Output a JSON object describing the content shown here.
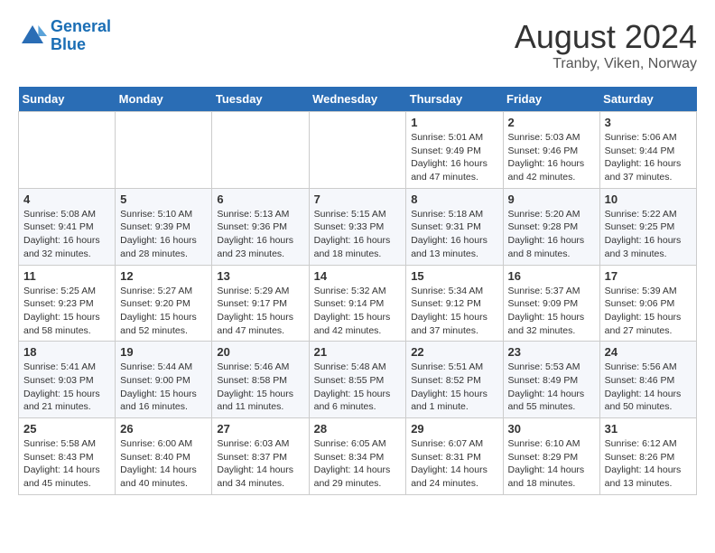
{
  "logo": {
    "line1": "General",
    "line2": "Blue"
  },
  "title": "August 2024",
  "subtitle": "Tranby, Viken, Norway",
  "header_days": [
    "Sunday",
    "Monday",
    "Tuesday",
    "Wednesday",
    "Thursday",
    "Friday",
    "Saturday"
  ],
  "weeks": [
    [
      {
        "day": "",
        "info": ""
      },
      {
        "day": "",
        "info": ""
      },
      {
        "day": "",
        "info": ""
      },
      {
        "day": "",
        "info": ""
      },
      {
        "day": "1",
        "info": "Sunrise: 5:01 AM\nSunset: 9:49 PM\nDaylight: 16 hours\nand 47 minutes."
      },
      {
        "day": "2",
        "info": "Sunrise: 5:03 AM\nSunset: 9:46 PM\nDaylight: 16 hours\nand 42 minutes."
      },
      {
        "day": "3",
        "info": "Sunrise: 5:06 AM\nSunset: 9:44 PM\nDaylight: 16 hours\nand 37 minutes."
      }
    ],
    [
      {
        "day": "4",
        "info": "Sunrise: 5:08 AM\nSunset: 9:41 PM\nDaylight: 16 hours\nand 32 minutes."
      },
      {
        "day": "5",
        "info": "Sunrise: 5:10 AM\nSunset: 9:39 PM\nDaylight: 16 hours\nand 28 minutes."
      },
      {
        "day": "6",
        "info": "Sunrise: 5:13 AM\nSunset: 9:36 PM\nDaylight: 16 hours\nand 23 minutes."
      },
      {
        "day": "7",
        "info": "Sunrise: 5:15 AM\nSunset: 9:33 PM\nDaylight: 16 hours\nand 18 minutes."
      },
      {
        "day": "8",
        "info": "Sunrise: 5:18 AM\nSunset: 9:31 PM\nDaylight: 16 hours\nand 13 minutes."
      },
      {
        "day": "9",
        "info": "Sunrise: 5:20 AM\nSunset: 9:28 PM\nDaylight: 16 hours\nand 8 minutes."
      },
      {
        "day": "10",
        "info": "Sunrise: 5:22 AM\nSunset: 9:25 PM\nDaylight: 16 hours\nand 3 minutes."
      }
    ],
    [
      {
        "day": "11",
        "info": "Sunrise: 5:25 AM\nSunset: 9:23 PM\nDaylight: 15 hours\nand 58 minutes."
      },
      {
        "day": "12",
        "info": "Sunrise: 5:27 AM\nSunset: 9:20 PM\nDaylight: 15 hours\nand 52 minutes."
      },
      {
        "day": "13",
        "info": "Sunrise: 5:29 AM\nSunset: 9:17 PM\nDaylight: 15 hours\nand 47 minutes."
      },
      {
        "day": "14",
        "info": "Sunrise: 5:32 AM\nSunset: 9:14 PM\nDaylight: 15 hours\nand 42 minutes."
      },
      {
        "day": "15",
        "info": "Sunrise: 5:34 AM\nSunset: 9:12 PM\nDaylight: 15 hours\nand 37 minutes."
      },
      {
        "day": "16",
        "info": "Sunrise: 5:37 AM\nSunset: 9:09 PM\nDaylight: 15 hours\nand 32 minutes."
      },
      {
        "day": "17",
        "info": "Sunrise: 5:39 AM\nSunset: 9:06 PM\nDaylight: 15 hours\nand 27 minutes."
      }
    ],
    [
      {
        "day": "18",
        "info": "Sunrise: 5:41 AM\nSunset: 9:03 PM\nDaylight: 15 hours\nand 21 minutes."
      },
      {
        "day": "19",
        "info": "Sunrise: 5:44 AM\nSunset: 9:00 PM\nDaylight: 15 hours\nand 16 minutes."
      },
      {
        "day": "20",
        "info": "Sunrise: 5:46 AM\nSunset: 8:58 PM\nDaylight: 15 hours\nand 11 minutes."
      },
      {
        "day": "21",
        "info": "Sunrise: 5:48 AM\nSunset: 8:55 PM\nDaylight: 15 hours\nand 6 minutes."
      },
      {
        "day": "22",
        "info": "Sunrise: 5:51 AM\nSunset: 8:52 PM\nDaylight: 15 hours\nand 1 minute."
      },
      {
        "day": "23",
        "info": "Sunrise: 5:53 AM\nSunset: 8:49 PM\nDaylight: 14 hours\nand 55 minutes."
      },
      {
        "day": "24",
        "info": "Sunrise: 5:56 AM\nSunset: 8:46 PM\nDaylight: 14 hours\nand 50 minutes."
      }
    ],
    [
      {
        "day": "25",
        "info": "Sunrise: 5:58 AM\nSunset: 8:43 PM\nDaylight: 14 hours\nand 45 minutes."
      },
      {
        "day": "26",
        "info": "Sunrise: 6:00 AM\nSunset: 8:40 PM\nDaylight: 14 hours\nand 40 minutes."
      },
      {
        "day": "27",
        "info": "Sunrise: 6:03 AM\nSunset: 8:37 PM\nDaylight: 14 hours\nand 34 minutes."
      },
      {
        "day": "28",
        "info": "Sunrise: 6:05 AM\nSunset: 8:34 PM\nDaylight: 14 hours\nand 29 minutes."
      },
      {
        "day": "29",
        "info": "Sunrise: 6:07 AM\nSunset: 8:31 PM\nDaylight: 14 hours\nand 24 minutes."
      },
      {
        "day": "30",
        "info": "Sunrise: 6:10 AM\nSunset: 8:29 PM\nDaylight: 14 hours\nand 18 minutes."
      },
      {
        "day": "31",
        "info": "Sunrise: 6:12 AM\nSunset: 8:26 PM\nDaylight: 14 hours\nand 13 minutes."
      }
    ]
  ]
}
